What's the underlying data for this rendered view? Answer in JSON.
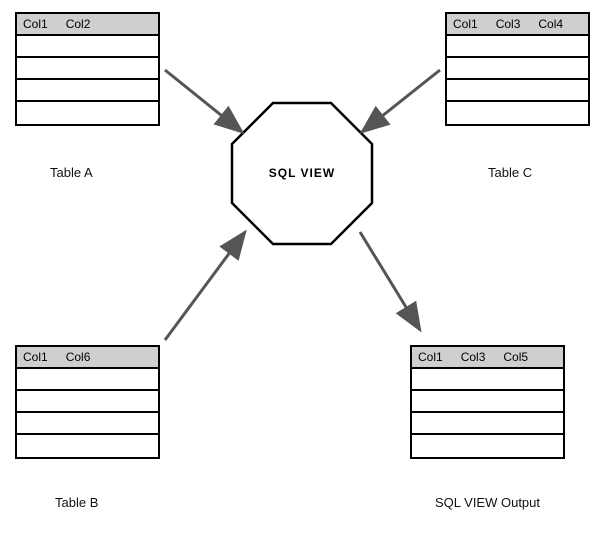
{
  "center": {
    "label": "SQL VIEW"
  },
  "tables": {
    "a": {
      "caption": "Table A",
      "cols": [
        "Col1",
        "Col2"
      ]
    },
    "b": {
      "caption": "Table B",
      "cols": [
        "Col1",
        "Col6"
      ]
    },
    "c": {
      "caption": "Table C",
      "cols": [
        "Col1",
        "Col3",
        "Col4"
      ]
    },
    "out": {
      "caption": "SQL VIEW Output",
      "cols": [
        "Col1",
        "Col3",
        "Col5"
      ]
    }
  }
}
